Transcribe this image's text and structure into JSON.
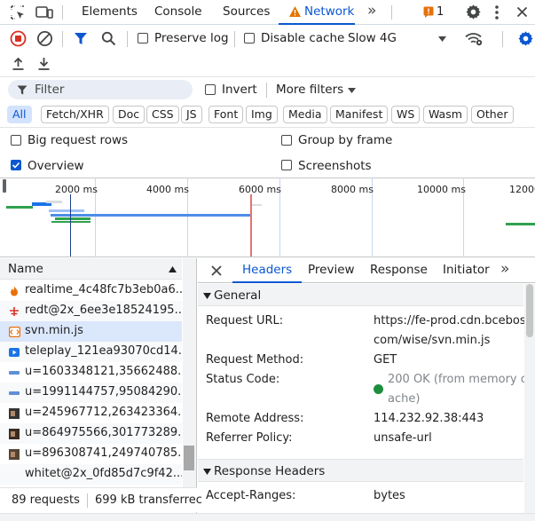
{
  "tabs": {
    "elements": "Elements",
    "console": "Console",
    "sources": "Sources",
    "network": "Network",
    "more": "»",
    "issues_count": "1"
  },
  "toolbar": {
    "preserve_log": "Preserve log",
    "disable_cache": "Disable cache",
    "throttle": "Slow 4G"
  },
  "filter": {
    "placeholder": "Filter",
    "invert": "Invert",
    "more_filters": "More filters"
  },
  "type_filters": [
    "All",
    "Fetch/XHR",
    "Doc",
    "CSS",
    "JS",
    "Font",
    "Img",
    "Media",
    "Manifest",
    "WS",
    "Wasm",
    "Other"
  ],
  "options": {
    "big_rows": "Big request rows",
    "group_by_frame": "Group by frame",
    "overview": "Overview",
    "screenshots": "Screenshots"
  },
  "overview_ticks": [
    "2000 ms",
    "4000 ms",
    "6000 ms",
    "8000 ms",
    "10000 ms",
    "12000"
  ],
  "list": {
    "header": "Name",
    "rows": [
      {
        "name": "realtime_4c48fc7b3eb0a6...",
        "icon": "fire-icon",
        "color": "#e8710a"
      },
      {
        "name": "redt@2x_6ee3e18524195...",
        "icon": "image-icon",
        "color": "#d93025"
      },
      {
        "name": "svn.min.js",
        "icon": "script-icon",
        "color": "#e8710a"
      },
      {
        "name": "teleplay_121ea93070cd14...",
        "icon": "play-icon",
        "color": "#1a73e8"
      },
      {
        "name": "u=1603348121,35662488...",
        "icon": "thumb-icon",
        "color": "#5f8fd6"
      },
      {
        "name": "u=1991144757,95084290...",
        "icon": "thumb-icon",
        "color": "#5f8fd6"
      },
      {
        "name": "u=245967712,263423364...",
        "icon": "thumb-icon",
        "color": "#333333"
      },
      {
        "name": "u=864975566,301773289...",
        "icon": "thumb-icon",
        "color": "#3a2a20"
      },
      {
        "name": "u=896308741,249740785...",
        "icon": "thumb-icon",
        "color": "#554433"
      },
      {
        "name": "whitet@2x_0fd85d7c9f42...",
        "icon": "none",
        "color": "#ffffff"
      }
    ],
    "status_requests": "89 requests",
    "status_transferred": "699 kB transferrec"
  },
  "details": {
    "tabs": [
      "Headers",
      "Preview",
      "Response",
      "Initiator"
    ],
    "general_title": "General",
    "request_url_key": "Request URL:",
    "request_url_value_1": "https://fe-prod.cdn.bcebos.",
    "request_url_value_2": "com/wise/svn.min.js",
    "request_method_key": "Request Method:",
    "request_method_value": "GET",
    "status_code_key": "Status Code:",
    "status_code_value_1": "200 OK (from memory c",
    "status_code_value_2": "ache)",
    "remote_address_key": "Remote Address:",
    "remote_address_value": "114.232.92.38:443",
    "referrer_policy_key": "Referrer Policy:",
    "referrer_policy_value": "unsafe-url",
    "response_headers_title": "Response Headers",
    "accept_ranges_key": "Accept-Ranges:",
    "accept_ranges_value": "bytes"
  }
}
